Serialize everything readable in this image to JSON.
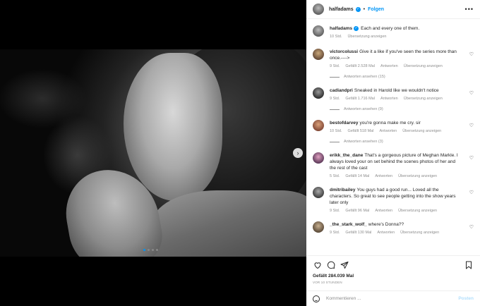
{
  "post": {
    "username": "halfadams",
    "follow_label": "Folgen",
    "caption_text": "Each and every one of them.",
    "caption_time": "10 Std.",
    "caption_translate": "Übersetzung anzeigen"
  },
  "comments": [
    {
      "user": "victorcolussi",
      "text": "Give it a like if you've seen the series more than once.---->",
      "time": "9 Std.",
      "likes": "Gefällt 2.528 Mal",
      "reply": "Antworten",
      "translate": "Übersetzung anzeigen",
      "view_replies": "Antworten ansehen (15)"
    },
    {
      "user": "cadiandpri",
      "text": "Sneaked in Harold like we wouldn't notice",
      "time": "9 Std.",
      "likes": "Gefällt 1.716 Mal",
      "reply": "Antworten",
      "translate": "Übersetzung anzeigen",
      "view_replies": "Antworten ansehen (9)"
    },
    {
      "user": "bestofdarvey",
      "text": "you're gonna make me cry. sir",
      "time": "10 Std.",
      "likes": "Gefällt 518 Mal",
      "reply": "Antworten",
      "translate": "Übersetzung anzeigen",
      "view_replies": "Antworten ansehen (3)"
    },
    {
      "user": "erikk_the_dane",
      "text": "That's a gorgeous picture of Meghan Markle. I always loved your on set behind the scenes photos of her and the rest of the cast",
      "time": "5 Std.",
      "likes": "Gefällt 14 Mal",
      "reply": "Antworten",
      "translate": "Übersetzung anzeigen"
    },
    {
      "user": "dmitribailey",
      "text": "You guys had a good run... Loved all the characters. So great to see people getting into the show years later only",
      "time": "9 Std.",
      "likes": "Gefällt 96 Mal",
      "reply": "Antworten",
      "translate": "Übersetzung anzeigen"
    },
    {
      "user": "_the_stark_wolf_",
      "text": "where's Donna??",
      "time": "9 Std.",
      "likes": "Gefällt 130 Mal",
      "reply": "Antworten",
      "translate": "Übersetzung anzeigen"
    }
  ],
  "footer": {
    "likes": "Gefällt 284.039 Mal",
    "time": "VOR 10 STUNDEN",
    "comment_placeholder": "Kommentieren ...",
    "post_label": "Posten"
  },
  "carousel": {
    "slides": 4,
    "active": 1
  },
  "colors": {
    "accent": "#0095f6",
    "muted": "#8e8e8e",
    "text": "#262626"
  }
}
